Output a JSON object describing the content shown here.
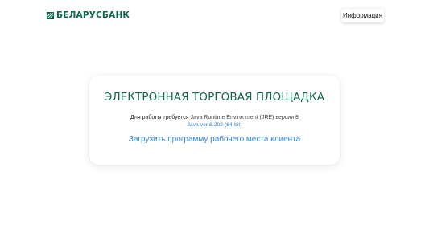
{
  "header": {
    "logo_text": "БЕЛАРУСБАНК",
    "logo_icon": "belarusbank-logo-icon",
    "info_button_label": "Информация"
  },
  "colors": {
    "brand_green": "#10684a",
    "link_blue": "#2f86dc"
  },
  "card": {
    "title": "ЭЛЕКТРОННАЯ ТОРГОВАЯ ПЛОЩАДКА",
    "requirement_prefix": "Для работы требуется",
    "requirement_software": "Java Runtime Environment (JRE) версии 8",
    "java_version_link": "Java ver 8.202 (64-bit)",
    "download_link": "Загрузить программу рабочего места клиента"
  }
}
